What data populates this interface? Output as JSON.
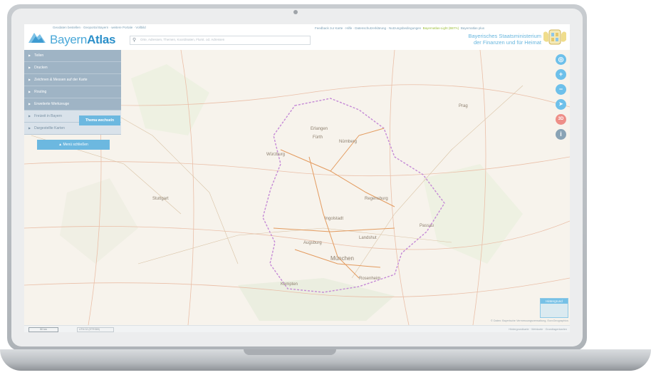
{
  "header": {
    "top_links": "Geodaten bestellen · Geoportal Bayern · weitere Portale · Vollbild",
    "brand_prefix": "Bayern",
    "brand_suffix": "Atlas",
    "search_placeholder": "Orte, Adressen, Themen, Koordinaten, Flurst. od. Adressen",
    "right_links": "Feedback zur Karte · Hilfe · Datenschutzerklärung · Nutzungsbedingungen",
    "highlight_link": "Bayernatlas-Light (BETA)",
    "extra_link": "Bayernatlas plus",
    "ministry_line1": "Bayerisches Staatsministerium",
    "ministry_line2": "der Finanzen und für Heimat"
  },
  "menu": {
    "items": [
      {
        "label": "Teilen"
      },
      {
        "label": "Drucken"
      },
      {
        "label": "Zeichnen & Messen auf der Karte"
      },
      {
        "label": "Routing"
      },
      {
        "label": "Erweiterte Werkzeuge"
      },
      {
        "label": "Freizeit in Bayern"
      },
      {
        "label": "Dargestellte Karten"
      }
    ],
    "theme_button": "Thema wechseln",
    "close_button": "Menü schließen"
  },
  "controls": [
    {
      "icon": "locate-icon",
      "glyph": "◎"
    },
    {
      "icon": "zoom-in-icon",
      "glyph": "+"
    },
    {
      "icon": "zoom-out-icon",
      "glyph": "−"
    },
    {
      "icon": "compass-icon",
      "glyph": "➤"
    },
    {
      "icon": "3d-icon",
      "glyph": "3D"
    },
    {
      "icon": "info-icon",
      "glyph": "i"
    }
  ],
  "map": {
    "cities": [
      "Prag",
      "Nürnberg",
      "Würzburg",
      "Erlangen",
      "Fürth",
      "Regensburg",
      "Ingolstadt",
      "Augsburg",
      "München",
      "Stuttgart",
      "Landshut",
      "Rosenheim",
      "Kempten",
      "Passau"
    ]
  },
  "background_thumb": "Hintergrund",
  "footer": {
    "scale": "50 km",
    "coord_select": "UTM 32 (ETRS89)",
    "copyright": "© Daten: Bayerische Vermessungsverwaltung, EuroGeographics",
    "background_text": "Hintergrundkarte · Webkarte · Grundlagenkarten"
  },
  "colors": {
    "accent": "#6cb8e0",
    "menu_bg": "#9fb4c5",
    "brand": "#2b8fc9"
  }
}
